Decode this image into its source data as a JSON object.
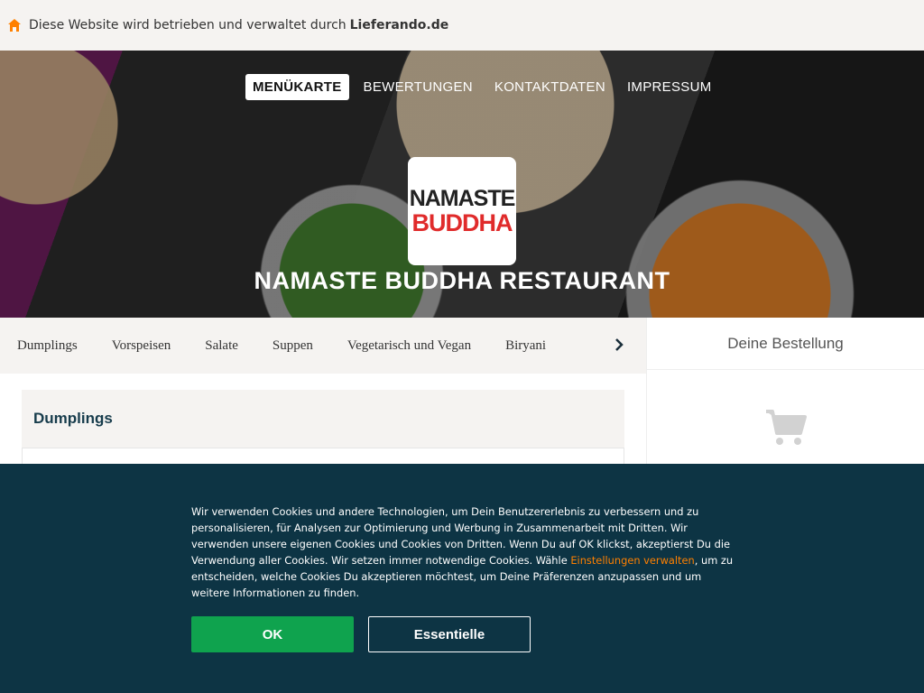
{
  "notice": {
    "text": "Diese Website wird betrieben und verwaltet durch",
    "brand": "Lieferando.de",
    "icon": "home-icon",
    "icon_color": "#ff8000"
  },
  "hero": {
    "nav": [
      "MENÜKARTE",
      "BEWERTUNGEN",
      "KONTAKTDATEN",
      "IMPRESSUM"
    ],
    "active_nav": "MENÜKARTE",
    "logo_line1": "NAMASTE",
    "logo_line2": "BUDDHA",
    "title": "NAMASTE BUDDHA RESTAURANT"
  },
  "categories": [
    "Dumplings",
    "Vorspeisen",
    "Salate",
    "Suppen",
    "Vegetarisch und Vegan",
    "Biryani"
  ],
  "main": {
    "section_title": "Dumplings"
  },
  "order": {
    "title": "Deine Bestellung",
    "icon": "cart-icon"
  },
  "cookie": {
    "text_before": "Wir verwenden Cookies und andere Technologien, um Dein Benutzererlebnis zu verbessern und zu personalisieren, für Analysen zur Optimierung und Werbung in Zusammenarbeit mit Dritten. Wir verwenden unsere eigenen Cookies und Cookies von Dritten. Wenn Du auf OK klickst, akzeptierst Du die Verwendung aller Cookies. Wir setzen immer notwendige Cookies. Wähle ",
    "link": "Einstellungen verwalten",
    "text_after": ", um zu entscheiden, welche Cookies Du akzeptieren möchtest, um Deine Präferenzen anzupassen und um weitere Informationen zu finden.",
    "ok_label": "OK",
    "essential_label": "Essentielle"
  },
  "colors": {
    "accent_orange": "#ff8000",
    "banner_bg": "#0d3444",
    "ok_green": "#0fa34e",
    "logo_red": "#e02b2b"
  }
}
